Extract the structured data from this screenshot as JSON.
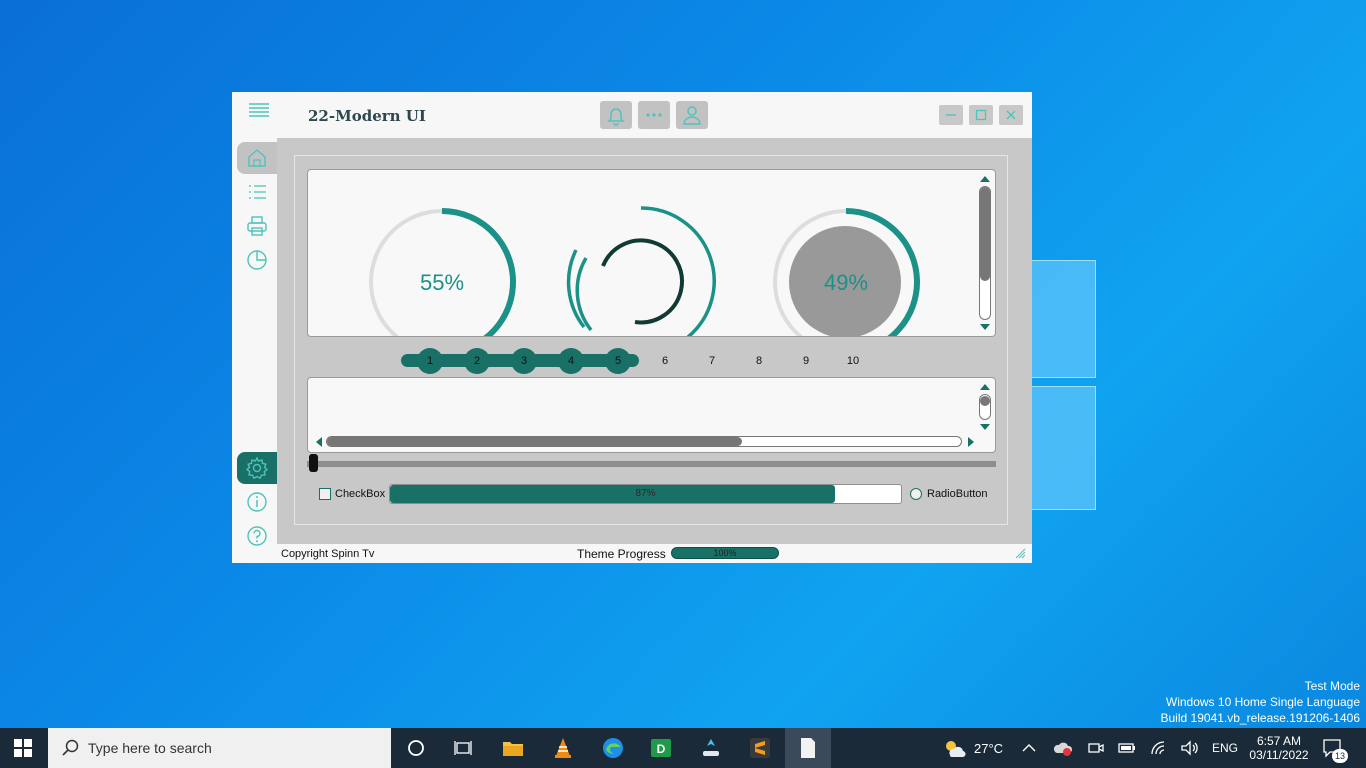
{
  "desktop": {
    "watermark": [
      "Test Mode",
      "Windows 10 Home Single Language",
      "Build 19041.vb_release.191206-1406"
    ]
  },
  "window": {
    "title": "22-Modern UI",
    "accent": "#197066",
    "gauges": [
      {
        "label": "55%",
        "value": 55
      },
      {
        "label": "",
        "value": 0
      },
      {
        "label": "49%",
        "value": 49
      }
    ],
    "tabs": [
      "1",
      "2",
      "3",
      "4",
      "5",
      "6",
      "7",
      "8",
      "9",
      "10"
    ],
    "active_tabs": 5,
    "checkbox_label": "CheckBox",
    "progress": {
      "value": 87,
      "label": "87%"
    },
    "radio_label": "RadioButton",
    "status": {
      "copyright": "Copyright Spinn Tv",
      "theme_label": "Theme Progress",
      "theme_value": "100%"
    }
  },
  "taskbar": {
    "search_placeholder": "Type here to search",
    "weather": "27°C",
    "language": "ENG",
    "time": "6:57 AM",
    "date": "03/11/2022",
    "notifications": "13"
  }
}
